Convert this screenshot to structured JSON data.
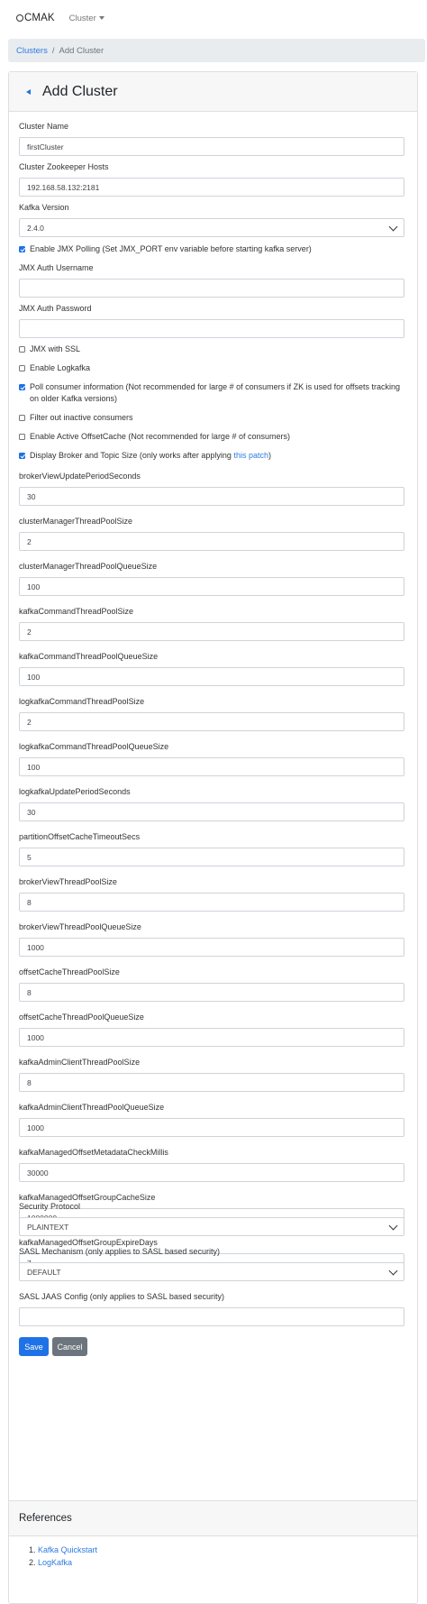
{
  "nav": {
    "brand": "CMAK",
    "cluster_menu": "Cluster"
  },
  "breadcrumb": {
    "link": "Clusters",
    "separator": "/",
    "current": "Add Cluster"
  },
  "header": {
    "title": "Add Cluster"
  },
  "form": {
    "cluster_name": {
      "label": "Cluster Name",
      "value": "firstCluster"
    },
    "zk_hosts": {
      "label": "Cluster Zookeeper Hosts",
      "value": "192.168.58.132:2181"
    },
    "kafka_version": {
      "label": "Kafka Version",
      "value": "2.4.0"
    },
    "jmx_polling": {
      "label": "Enable JMX Polling (Set JMX_PORT env variable before starting kafka server)",
      "checked": true
    },
    "jmx_user": {
      "label": "JMX Auth Username",
      "value": ""
    },
    "jmx_pass": {
      "label": "JMX Auth Password",
      "value": ""
    },
    "jmx_ssl": {
      "label": "JMX with SSL",
      "checked": false
    },
    "logkafka": {
      "label": "Enable Logkafka",
      "checked": false
    },
    "poll_consumer": {
      "label": "Poll consumer information (Not recommended for large # of consumers if ZK is used for offsets tracking on older Kafka versions)",
      "checked": true
    },
    "filter_inactive": {
      "label": "Filter out inactive consumers",
      "checked": false
    },
    "active_offset_cache": {
      "label": "Enable Active OffsetCache (Not recommended for large # of consumers)",
      "checked": false
    },
    "display_size": {
      "label": "Display Broker and Topic Size (only works after applying ",
      "link": "this patch",
      "suffix": ")",
      "checked": true
    },
    "fields": [
      {
        "label": "brokerViewUpdatePeriodSeconds",
        "value": "30"
      },
      {
        "label": "clusterManagerThreadPoolSize",
        "value": "2"
      },
      {
        "label": "clusterManagerThreadPoolQueueSize",
        "value": "100"
      },
      {
        "label": "kafkaCommandThreadPoolSize",
        "value": "2"
      },
      {
        "label": "kafkaCommandThreadPoolQueueSize",
        "value": "100"
      },
      {
        "label": "logkafkaCommandThreadPoolSize",
        "value": "2"
      },
      {
        "label": "logkafkaCommandThreadPoolQueueSize",
        "value": "100"
      },
      {
        "label": "logkafkaUpdatePeriodSeconds",
        "value": "30"
      },
      {
        "label": "partitionOffsetCacheTimeoutSecs",
        "value": "5"
      },
      {
        "label": "brokerViewThreadPoolSize",
        "value": "8"
      },
      {
        "label": "brokerViewThreadPoolQueueSize",
        "value": "1000"
      },
      {
        "label": "offsetCacheThreadPoolSize",
        "value": "8"
      },
      {
        "label": "offsetCacheThreadPoolQueueSize",
        "value": "1000"
      },
      {
        "label": "kafkaAdminClientThreadPoolSize",
        "value": "8"
      },
      {
        "label": "kafkaAdminClientThreadPoolQueueSize",
        "value": "1000"
      },
      {
        "label": "kafkaManagedOffsetMetadataCheckMillis",
        "value": "30000"
      },
      {
        "label": "kafkaManagedOffsetGroupCacheSize",
        "value": "1000000"
      },
      {
        "label": "kafkaManagedOffsetGroupExpireDays",
        "value": "7"
      }
    ],
    "security_protocol": {
      "label": "Security Protocol",
      "value": "PLAINTEXT"
    },
    "sasl_mechanism": {
      "label": "SASL Mechanism (only applies to SASL based security)",
      "value": "DEFAULT"
    },
    "sasl_jaas": {
      "label": "SASL JAAS Config (only applies to SASL based security)",
      "value": ""
    },
    "save_label": "Save",
    "cancel_label": "Cancel"
  },
  "references": {
    "title": "References",
    "items": [
      {
        "num": "1.",
        "label": "Kafka Quickstart"
      },
      {
        "num": "2.",
        "label": "LogKafka"
      }
    ]
  },
  "colors": {
    "primary": "#1f72e6",
    "secondary": "#6c757d",
    "link": "#2f7be0",
    "breadcrumb_bg": "#e9ecef",
    "card_header_bg": "#f7f7f7"
  }
}
